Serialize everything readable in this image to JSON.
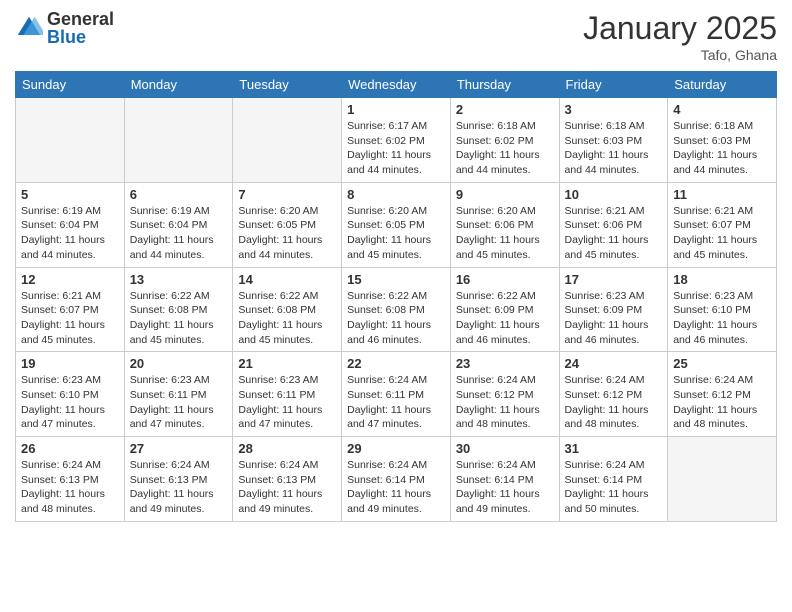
{
  "logo": {
    "general": "General",
    "blue": "Blue"
  },
  "title": "January 2025",
  "location": "Tafo, Ghana",
  "days_of_week": [
    "Sunday",
    "Monday",
    "Tuesday",
    "Wednesday",
    "Thursday",
    "Friday",
    "Saturday"
  ],
  "weeks": [
    [
      {
        "day": "",
        "info": ""
      },
      {
        "day": "",
        "info": ""
      },
      {
        "day": "",
        "info": ""
      },
      {
        "day": "1",
        "info": "Sunrise: 6:17 AM\nSunset: 6:02 PM\nDaylight: 11 hours and 44 minutes."
      },
      {
        "day": "2",
        "info": "Sunrise: 6:18 AM\nSunset: 6:02 PM\nDaylight: 11 hours and 44 minutes."
      },
      {
        "day": "3",
        "info": "Sunrise: 6:18 AM\nSunset: 6:03 PM\nDaylight: 11 hours and 44 minutes."
      },
      {
        "day": "4",
        "info": "Sunrise: 6:18 AM\nSunset: 6:03 PM\nDaylight: 11 hours and 44 minutes."
      }
    ],
    [
      {
        "day": "5",
        "info": "Sunrise: 6:19 AM\nSunset: 6:04 PM\nDaylight: 11 hours and 44 minutes."
      },
      {
        "day": "6",
        "info": "Sunrise: 6:19 AM\nSunset: 6:04 PM\nDaylight: 11 hours and 44 minutes."
      },
      {
        "day": "7",
        "info": "Sunrise: 6:20 AM\nSunset: 6:05 PM\nDaylight: 11 hours and 44 minutes."
      },
      {
        "day": "8",
        "info": "Sunrise: 6:20 AM\nSunset: 6:05 PM\nDaylight: 11 hours and 45 minutes."
      },
      {
        "day": "9",
        "info": "Sunrise: 6:20 AM\nSunset: 6:06 PM\nDaylight: 11 hours and 45 minutes."
      },
      {
        "day": "10",
        "info": "Sunrise: 6:21 AM\nSunset: 6:06 PM\nDaylight: 11 hours and 45 minutes."
      },
      {
        "day": "11",
        "info": "Sunrise: 6:21 AM\nSunset: 6:07 PM\nDaylight: 11 hours and 45 minutes."
      }
    ],
    [
      {
        "day": "12",
        "info": "Sunrise: 6:21 AM\nSunset: 6:07 PM\nDaylight: 11 hours and 45 minutes."
      },
      {
        "day": "13",
        "info": "Sunrise: 6:22 AM\nSunset: 6:08 PM\nDaylight: 11 hours and 45 minutes."
      },
      {
        "day": "14",
        "info": "Sunrise: 6:22 AM\nSunset: 6:08 PM\nDaylight: 11 hours and 45 minutes."
      },
      {
        "day": "15",
        "info": "Sunrise: 6:22 AM\nSunset: 6:08 PM\nDaylight: 11 hours and 46 minutes."
      },
      {
        "day": "16",
        "info": "Sunrise: 6:22 AM\nSunset: 6:09 PM\nDaylight: 11 hours and 46 minutes."
      },
      {
        "day": "17",
        "info": "Sunrise: 6:23 AM\nSunset: 6:09 PM\nDaylight: 11 hours and 46 minutes."
      },
      {
        "day": "18",
        "info": "Sunrise: 6:23 AM\nSunset: 6:10 PM\nDaylight: 11 hours and 46 minutes."
      }
    ],
    [
      {
        "day": "19",
        "info": "Sunrise: 6:23 AM\nSunset: 6:10 PM\nDaylight: 11 hours and 47 minutes."
      },
      {
        "day": "20",
        "info": "Sunrise: 6:23 AM\nSunset: 6:11 PM\nDaylight: 11 hours and 47 minutes."
      },
      {
        "day": "21",
        "info": "Sunrise: 6:23 AM\nSunset: 6:11 PM\nDaylight: 11 hours and 47 minutes."
      },
      {
        "day": "22",
        "info": "Sunrise: 6:24 AM\nSunset: 6:11 PM\nDaylight: 11 hours and 47 minutes."
      },
      {
        "day": "23",
        "info": "Sunrise: 6:24 AM\nSunset: 6:12 PM\nDaylight: 11 hours and 48 minutes."
      },
      {
        "day": "24",
        "info": "Sunrise: 6:24 AM\nSunset: 6:12 PM\nDaylight: 11 hours and 48 minutes."
      },
      {
        "day": "25",
        "info": "Sunrise: 6:24 AM\nSunset: 6:12 PM\nDaylight: 11 hours and 48 minutes."
      }
    ],
    [
      {
        "day": "26",
        "info": "Sunrise: 6:24 AM\nSunset: 6:13 PM\nDaylight: 11 hours and 48 minutes."
      },
      {
        "day": "27",
        "info": "Sunrise: 6:24 AM\nSunset: 6:13 PM\nDaylight: 11 hours and 49 minutes."
      },
      {
        "day": "28",
        "info": "Sunrise: 6:24 AM\nSunset: 6:13 PM\nDaylight: 11 hours and 49 minutes."
      },
      {
        "day": "29",
        "info": "Sunrise: 6:24 AM\nSunset: 6:14 PM\nDaylight: 11 hours and 49 minutes."
      },
      {
        "day": "30",
        "info": "Sunrise: 6:24 AM\nSunset: 6:14 PM\nDaylight: 11 hours and 49 minutes."
      },
      {
        "day": "31",
        "info": "Sunrise: 6:24 AM\nSunset: 6:14 PM\nDaylight: 11 hours and 50 minutes."
      },
      {
        "day": "",
        "info": ""
      }
    ]
  ]
}
